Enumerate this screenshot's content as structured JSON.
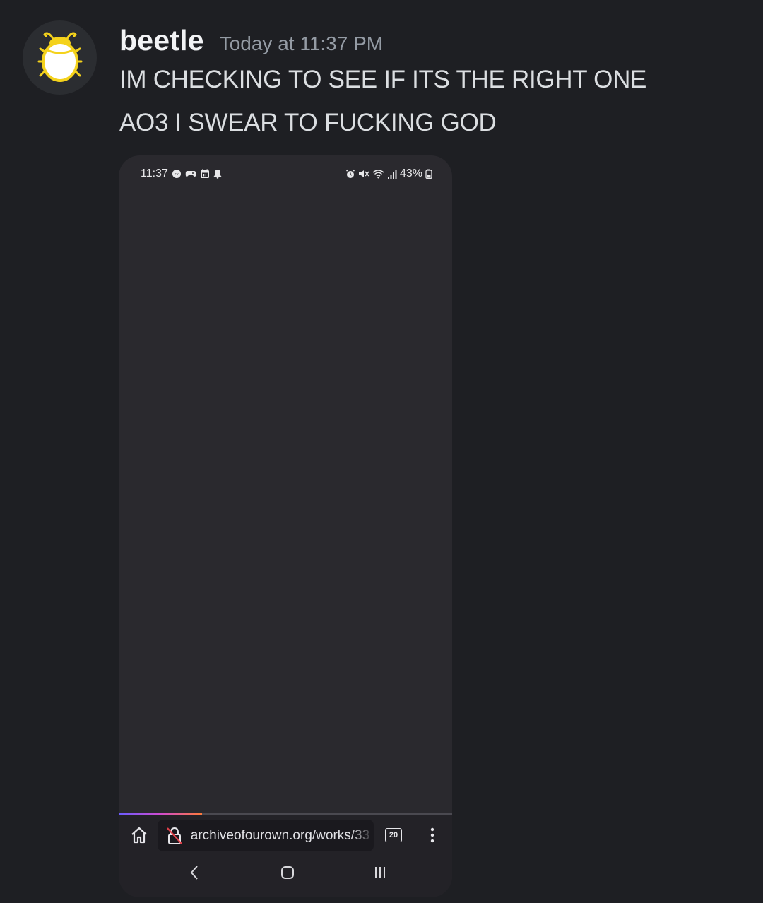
{
  "message": {
    "username": "beetle",
    "timestamp": "Today at 11:37 PM",
    "lines": [
      "IM CHECKING TO SEE IF ITS THE RIGHT ONE",
      "AO3 I SWEAR TO FUCKING GOD"
    ]
  },
  "avatar": {
    "icon": "beetle-icon",
    "color": "#f4d21c"
  },
  "screenshot": {
    "status_bar": {
      "time": "11:37",
      "battery": "43%",
      "left_icons": [
        "messenger-icon",
        "game-controller-icon",
        "calendar-icon",
        "bell-icon"
      ],
      "right_icons": [
        "alarm-icon",
        "mute-icon",
        "wifi-icon",
        "signal-icon",
        "battery-icon"
      ]
    },
    "page_load_progress": 0.25,
    "toolbar": {
      "url": "archiveofourown.org/works/33",
      "tab_count": "20",
      "icons": [
        "home-icon",
        "insecure-lock-icon",
        "more-vert-icon"
      ]
    },
    "nav_bar": {
      "icons": [
        "back-icon",
        "home-circle-icon",
        "recent-apps-icon"
      ]
    }
  },
  "colors": {
    "background": "#1e1f23",
    "username": "#f2f3f5",
    "timestamp": "#949ba4",
    "screenshot_bg": "#2a292e",
    "progress_gradient": [
      "#6a5cff",
      "#d04bd0",
      "#ff7a3a"
    ]
  }
}
